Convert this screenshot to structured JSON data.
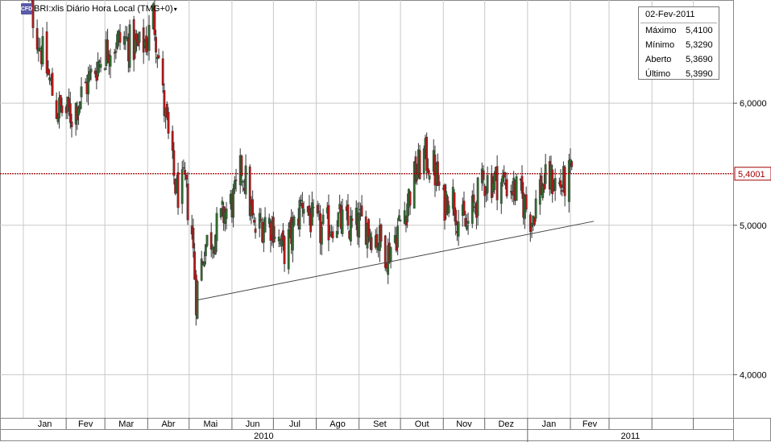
{
  "header": {
    "title": "BRI:xlis Diário Hora Local (TMG+0)",
    "logo_text": "CFD"
  },
  "info_box": {
    "date": "02-Fev-2011",
    "rows": [
      {
        "label": "Máximo",
        "value": "5,4100"
      },
      {
        "label": "Mínimo",
        "value": "5,3290"
      },
      {
        "label": "Aberto",
        "value": "5,3690"
      },
      {
        "label": "Último",
        "value": "5,3990"
      }
    ]
  },
  "colors": {
    "up": "#2f6b2f",
    "down": "#b31818",
    "price_line": "#a00000",
    "grid": "#c8c8c8"
  },
  "chart_data": {
    "type": "candlestick",
    "y_scale": "log",
    "ylim": [
      3.75,
      7.0
    ],
    "y_ticks": [
      {
        "v": 4,
        "label": "4,0000"
      },
      {
        "v": 5,
        "label": "5,0000"
      },
      {
        "v": 6,
        "label": "6,0000"
      }
    ],
    "current_price": {
      "value": 5.4001,
      "label": "5,4001"
    },
    "months": [
      "Jan",
      "Fev",
      "Mar",
      "Abr",
      "Mai",
      "Jun",
      "Jul",
      "Ago",
      "Set",
      "Out",
      "Nov",
      "Dez",
      "Jan",
      "Fev"
    ],
    "years": [
      "2010",
      "2011"
    ],
    "trendline": {
      "start": {
        "date": "2010-05-06",
        "value": 4.47
      },
      "end": {
        "date": "2011-02-18",
        "value": 5.03
      }
    },
    "close_path": [
      [
        "2010-01-02",
        7.2
      ],
      [
        "2010-01-12",
        6.6
      ],
      [
        "2010-01-20",
        6.2
      ],
      [
        "2010-01-25",
        5.95
      ],
      [
        "2010-02-05",
        5.9
      ],
      [
        "2010-02-15",
        6.15
      ],
      [
        "2010-02-25",
        6.4
      ],
      [
        "2010-03-05",
        6.55
      ],
      [
        "2010-03-15",
        6.6
      ],
      [
        "2010-03-25",
        6.5
      ],
      [
        "2010-04-01",
        6.6
      ],
      [
        "2010-04-05",
        6.85
      ],
      [
        "2010-04-08",
        6.55
      ],
      [
        "2010-04-12",
        6.05
      ],
      [
        "2010-04-18",
        5.5
      ],
      [
        "2010-04-22",
        5.25
      ],
      [
        "2010-04-28",
        5.3
      ],
      [
        "2010-05-03",
        4.95
      ],
      [
        "2010-05-06",
        4.5
      ],
      [
        "2010-05-12",
        4.85
      ],
      [
        "2010-05-20",
        4.95
      ],
      [
        "2010-05-27",
        5.1
      ],
      [
        "2010-06-03",
        5.2
      ],
      [
        "2010-06-08",
        5.45
      ],
      [
        "2010-06-12",
        5.3
      ],
      [
        "2010-06-17",
        4.95
      ],
      [
        "2010-06-25",
        5.05
      ],
      [
        "2010-07-01",
        5.0
      ],
      [
        "2010-07-08",
        4.8
      ],
      [
        "2010-07-15",
        4.95
      ],
      [
        "2010-07-22",
        5.2
      ],
      [
        "2010-07-30",
        5.0
      ],
      [
        "2010-08-05",
        4.95
      ],
      [
        "2010-08-15",
        5.05
      ],
      [
        "2010-08-25",
        4.98
      ],
      [
        "2010-09-05",
        5.02
      ],
      [
        "2010-09-15",
        4.9
      ],
      [
        "2010-09-22",
        4.8
      ],
      [
        "2010-09-30",
        5.0
      ],
      [
        "2010-10-05",
        5.15
      ],
      [
        "2010-10-12",
        5.4
      ],
      [
        "2010-10-18",
        5.55
      ],
      [
        "2010-10-25",
        5.45
      ],
      [
        "2010-11-01",
        5.15
      ],
      [
        "2010-11-06",
        5.3
      ],
      [
        "2010-11-12",
        5.05
      ],
      [
        "2010-11-18",
        4.98
      ],
      [
        "2010-11-25",
        5.2
      ],
      [
        "2010-12-01",
        5.35
      ],
      [
        "2010-12-10",
        5.35
      ],
      [
        "2010-12-20",
        5.3
      ],
      [
        "2010-12-28",
        5.2
      ],
      [
        "2011-01-04",
        5.05
      ],
      [
        "2011-01-10",
        5.3
      ],
      [
        "2011-01-18",
        5.35
      ],
      [
        "2011-01-26",
        5.3
      ],
      [
        "2011-02-02",
        5.399
      ]
    ]
  }
}
